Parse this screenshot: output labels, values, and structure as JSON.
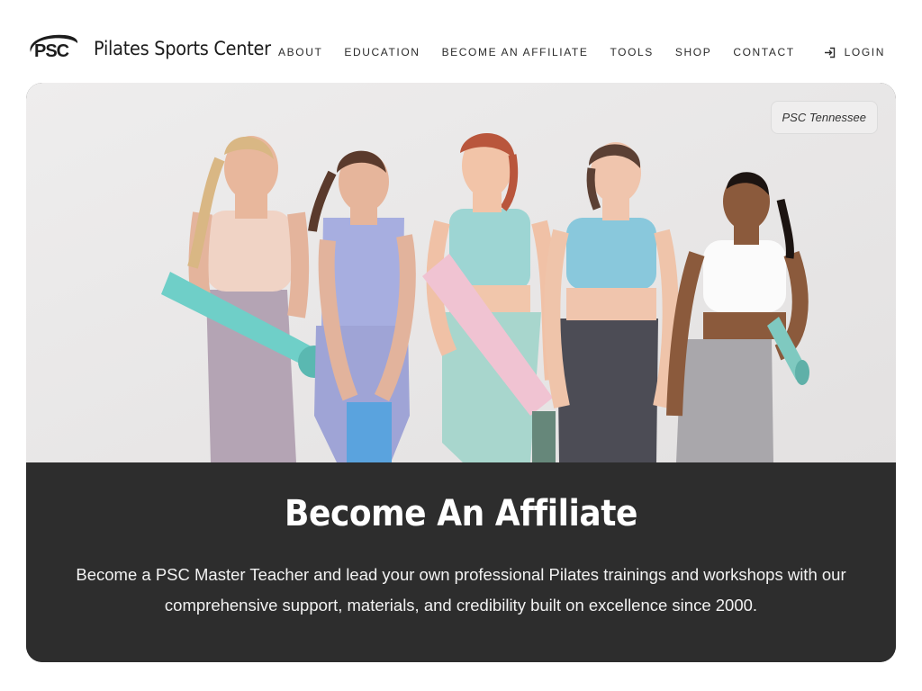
{
  "brand": {
    "logo_text": "PSC",
    "name": "Pilates Sports Center"
  },
  "nav": {
    "items": [
      "ABOUT",
      "EDUCATION",
      "BECOME AN AFFILIATE",
      "TOOLS",
      "SHOP",
      "CONTACT"
    ],
    "login_label": "LOGIN"
  },
  "hero": {
    "location_badge": "PSC Tennessee",
    "title": "Become An Affiliate",
    "description": "Become a PSC Master Teacher and lead your own professional Pilates trainings and workshops with our comprehensive support, materials, and credibility built on excellence since 2000."
  },
  "colors": {
    "panel_bg": "#2d2d2d",
    "photo_wall": "#ecebeb",
    "mat_teal": "#6fcfc8",
    "mat_pink": "#f0c3d2"
  },
  "icons": {
    "login": "login-icon",
    "logo": "psc-logo-icon"
  }
}
